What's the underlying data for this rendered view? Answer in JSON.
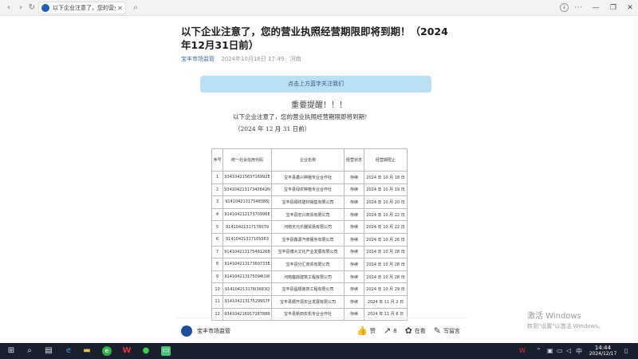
{
  "browser": {
    "tab_title": "以下企业注意了，您的营业执",
    "tab_close": "✕",
    "back": "‹",
    "forward": "›",
    "reload": "↻",
    "search_glyph": "⌕",
    "min": "—",
    "max": "❐",
    "close": "✕"
  },
  "article": {
    "title": "以下企业注意了，您的营业执照经营期限即将到期！（2024年12月31日前）",
    "author": "宝丰市场监管",
    "date": "2024年10月16日 17:49",
    "location": "河南",
    "follow_label": "点击上方蓝字关注我们"
  },
  "notice": {
    "heading": "重要提醒！！！",
    "line1": "以下企业注意了，您的营业执照经营期限即将到期！",
    "line2": "（2024 年 12 月 31 日前）"
  },
  "table": {
    "headers": [
      "序号",
      "统一社会信用代码",
      "企业名称",
      "经营状态",
      "经营期限止"
    ],
    "rows": [
      [
        "1",
        "93410421563716992E",
        "宝丰县鑫兴种植专业合作社",
        "存续",
        "2024 年 10 月 18 日"
      ],
      [
        "2",
        "93410421317343642N",
        "宝丰县绿农种植专业合作社",
        "存续",
        "2024 年 10 月 19 日"
      ],
      [
        "3",
        "91410421317548386J",
        "宝丰县顺祥建材销售有限公司",
        "存续",
        "2024 年 10 月 20 日"
      ],
      [
        "4",
        "91410421217370996E",
        "宝丰县宏兴商贸有限公司",
        "存续",
        "2024 年 10 月 22 日"
      ],
      [
        "5",
        "91410421317178079",
        "河南天元乐器贸易有限公司",
        "存续",
        "2024 年 10 月 22 日"
      ],
      [
        "6",
        "91410421317165563",
        "宝丰县鑫源汽修服务有限公司",
        "存续",
        "2024 年 10 月 26 日"
      ],
      [
        "7",
        "91410421317548126B",
        "宝丰县博大文化产业发展有限公司",
        "存续",
        "2024 年 10 月 28 日"
      ],
      [
        "8",
        "91410421317360733E",
        "宝丰县分汇商贸有限公司",
        "存续",
        "2024 年 10 月 28 日"
      ],
      [
        "9",
        "914104213175094l1W",
        "河南塞鼎建筑工程有限公司",
        "存续",
        "2024 年 10 月 28 日"
      ],
      [
        "10",
        "914104213176l3683Q",
        "宝丰县昌顺装饰工程有限公司",
        "存续",
        "2024 年 10 月 29 日"
      ],
      [
        "11",
        "914104213175299S7F",
        "宝丰县顺开源农业发展有限公司",
        "存续",
        "2024 年 11 月 2 日"
      ],
      [
        "12",
        "93410421691728788R",
        "宝丰县新田农机专业合作社",
        "存续",
        "2024 年 11 月 6 日"
      ]
    ]
  },
  "bottom": {
    "account": "宝丰市场监管",
    "like": "赞",
    "share_count": "8",
    "viewing": "在看",
    "comment": "写留言"
  },
  "watermark": {
    "line1": "激活 Windows",
    "line2": "转到\"设置\"以激活 Windows。"
  },
  "taskbar": {
    "time": "14:44",
    "date": "2024/12/17",
    "ime": "中"
  }
}
